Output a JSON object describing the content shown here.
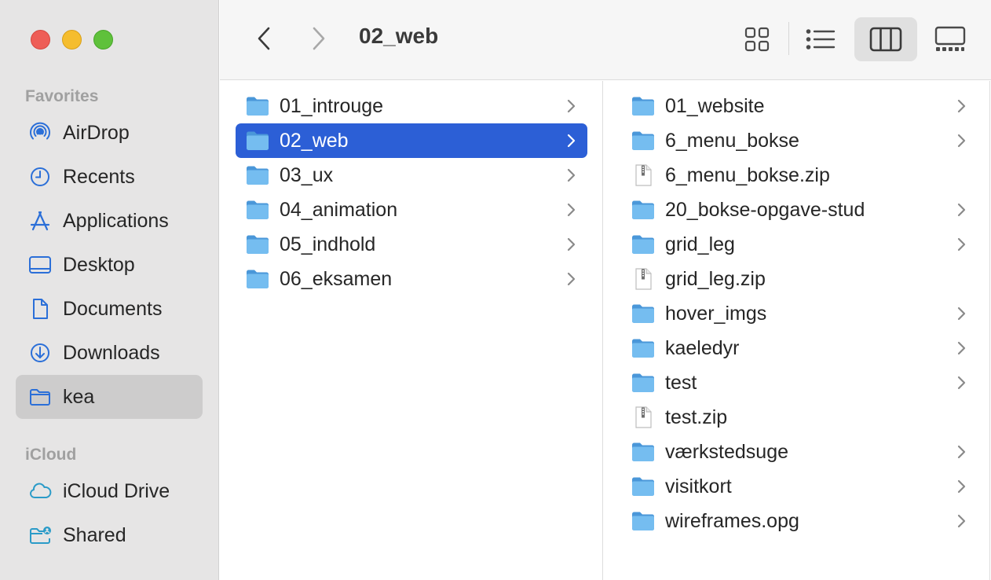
{
  "window": {
    "title": "02_web"
  },
  "sidebar": {
    "favorites_heading": "Favorites",
    "icloud_heading": "iCloud",
    "favorites": [
      {
        "label": "AirDrop",
        "icon": "airdrop-icon"
      },
      {
        "label": "Recents",
        "icon": "clock-icon"
      },
      {
        "label": "Applications",
        "icon": "applications-icon"
      },
      {
        "label": "Desktop",
        "icon": "desktop-icon"
      },
      {
        "label": "Documents",
        "icon": "document-icon"
      },
      {
        "label": "Downloads",
        "icon": "download-icon"
      },
      {
        "label": "kea",
        "icon": "folder-icon",
        "selected": true
      }
    ],
    "icloud": [
      {
        "label": "iCloud Drive",
        "icon": "cloud-icon"
      },
      {
        "label": "Shared",
        "icon": "shared-folder-icon"
      }
    ]
  },
  "toolbar": {
    "back": "chevron-left-icon",
    "forward": "chevron-right-icon",
    "views": [
      "icon-view",
      "list-view",
      "column-view",
      "gallery-view"
    ],
    "active_view": "column-view"
  },
  "columns": [
    {
      "items": [
        {
          "name": "01_introuge",
          "type": "folder"
        },
        {
          "name": "02_web",
          "type": "folder",
          "selected": true
        },
        {
          "name": "03_ux",
          "type": "folder"
        },
        {
          "name": "04_animation",
          "type": "folder"
        },
        {
          "name": "05_indhold",
          "type": "folder"
        },
        {
          "name": "06_eksamen",
          "type": "folder"
        }
      ]
    },
    {
      "items": [
        {
          "name": "01_website",
          "type": "folder"
        },
        {
          "name": "6_menu_bokse",
          "type": "folder"
        },
        {
          "name": "6_menu_bokse.zip",
          "type": "zip"
        },
        {
          "name": "20_bokse-opgave-stud",
          "type": "folder"
        },
        {
          "name": "grid_leg",
          "type": "folder"
        },
        {
          "name": "grid_leg.zip",
          "type": "zip"
        },
        {
          "name": "hover_imgs",
          "type": "folder"
        },
        {
          "name": "kaeledyr",
          "type": "folder"
        },
        {
          "name": "test",
          "type": "folder"
        },
        {
          "name": "test.zip",
          "type": "zip"
        },
        {
          "name": "værkstedsuge",
          "type": "folder"
        },
        {
          "name": "visitkort",
          "type": "folder"
        },
        {
          "name": "wireframes.opg",
          "type": "folder"
        }
      ]
    }
  ],
  "colors": {
    "selection": "#2c5fd6",
    "sidebar_icon": "#2b6fd8",
    "folder": "#6fb4ea"
  }
}
